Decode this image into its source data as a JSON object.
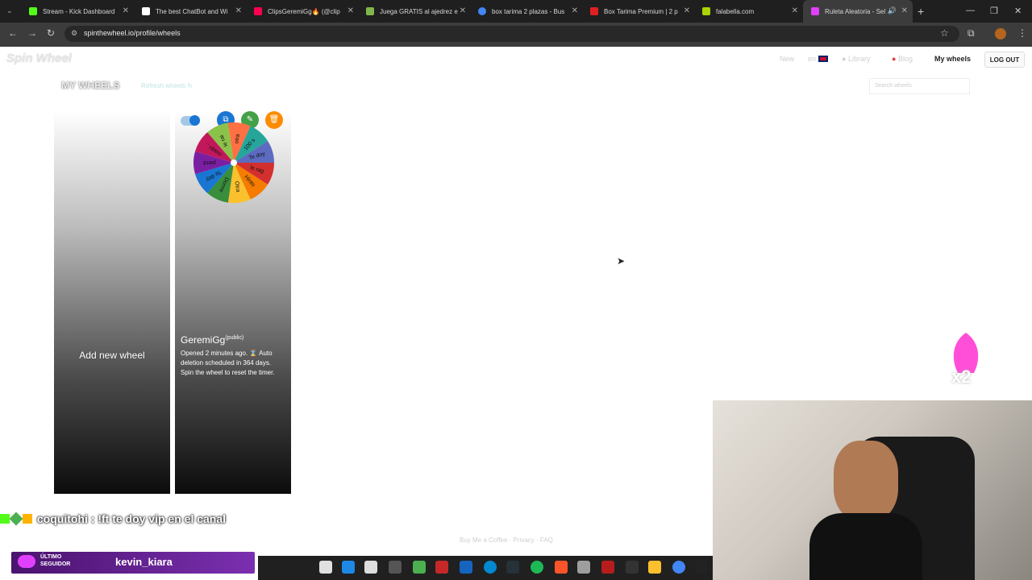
{
  "browser": {
    "tabs": [
      {
        "title": "Stream - Kick Dashboard",
        "color": "#53fc18"
      },
      {
        "title": "The best ChatBot and Wi",
        "color": "#ffffff"
      },
      {
        "title": "ClipsGeremiGg🔥 (@clip",
        "color": "#ff0050"
      },
      {
        "title": "Juega GRATIS al ajedrez e",
        "color": "#81b64c"
      },
      {
        "title": "box tarima 2 plazas - Bus",
        "color": "#4285f4"
      },
      {
        "title": "Box Tarima Premium | 2 p",
        "color": "#e02020"
      },
      {
        "title": "falabella.com",
        "color": "#aad500"
      },
      {
        "title": "Ruleta Aleatoria - Sel",
        "color": "#e040fb"
      }
    ],
    "url": "spinthewheel.io/profile/wheels"
  },
  "site": {
    "logo": "Spin Wheel",
    "nav": {
      "new": "New",
      "lang": "en",
      "library": "Library",
      "blog": "Blog",
      "my_wheels": "My wheels",
      "logout": "LOG OUT"
    },
    "search_placeholder": "Search wheels",
    "heading": "MY WHEELS",
    "refresh": "Refresh wheels",
    "add_new": "Add new wheel",
    "wheel": {
      "name": "GeremiGg",
      "visibility": "(public)",
      "desc": "Opened 2 minutes ago. ⌛ Auto deletion scheduled in 364 days. Spin the wheel to reset the timer.",
      "segments": [
        "le rag",
        "Hinto",
        "Otra",
        "Dorrre",
        "Te doy",
        "pierd",
        "maqu...",
        "le rai",
        "otra",
        "100 s",
        "Te doy"
      ]
    },
    "footer": "Buy Me a Coffee · Privacy · FAQ"
  },
  "overlay": {
    "chat": "coquitohi : !ft te doy vip en el canal",
    "follower_label": "ÚLTIMO SEGUIDOR",
    "follower_name": "kevin_kiara",
    "multiplier": "x2"
  }
}
